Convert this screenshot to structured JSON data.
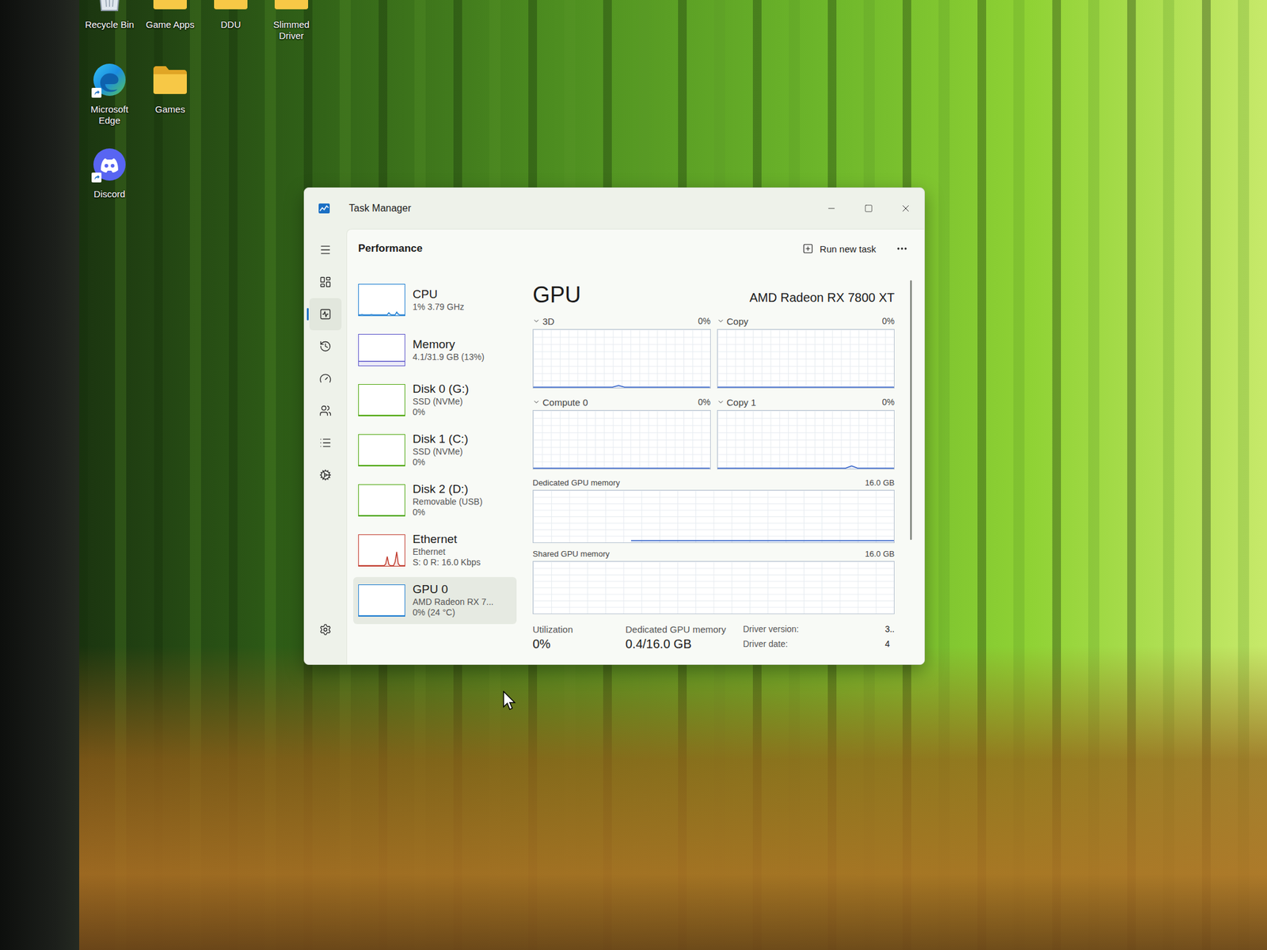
{
  "desktop": {
    "icon_rows": [
      [
        {
          "label": "Recycle Bin",
          "kind": "recycle",
          "shortcut": false
        },
        {
          "label": "Game Apps",
          "kind": "folder",
          "shortcut": false
        },
        {
          "label": "DDU",
          "kind": "folder",
          "shortcut": false
        },
        {
          "label": "Slimmed Driver",
          "kind": "folder",
          "shortcut": false
        }
      ],
      [
        {
          "label": "Microsoft Edge",
          "kind": "edge",
          "shortcut": true
        },
        {
          "label": "Games",
          "kind": "folder",
          "shortcut": false
        }
      ],
      [
        {
          "label": "Discord",
          "kind": "discord",
          "shortcut": true
        }
      ]
    ]
  },
  "window": {
    "title": "Task Manager"
  },
  "nav": {
    "items": [
      {
        "kind": "menu",
        "selected": false
      },
      {
        "kind": "processes",
        "selected": false
      },
      {
        "kind": "performance",
        "selected": true
      },
      {
        "kind": "history",
        "selected": false
      },
      {
        "kind": "startup",
        "selected": false
      },
      {
        "kind": "users",
        "selected": false
      },
      {
        "kind": "details",
        "selected": false
      },
      {
        "kind": "services",
        "selected": false
      }
    ],
    "footer": {
      "kind": "settings",
      "selected": false
    }
  },
  "header": {
    "title": "Performance",
    "action": "Run new task"
  },
  "devices": [
    {
      "name": "CPU",
      "lines": [
        "1% 3.79 GHz"
      ],
      "selected": false,
      "color": "#1a7bd0",
      "values": [
        1,
        1,
        2,
        1,
        1,
        1,
        1,
        1,
        2,
        1,
        1,
        1,
        1,
        1,
        1,
        1,
        1,
        1,
        1,
        8,
        2,
        1,
        1,
        1,
        10,
        3,
        1,
        1,
        1,
        1
      ]
    },
    {
      "name": "Memory",
      "lines": [
        "4.1/31.9 GB (13%)"
      ],
      "selected": false,
      "color": "#5b55c9",
      "values": [
        13,
        13,
        13,
        13,
        13,
        13,
        13,
        13,
        13,
        13,
        13,
        13,
        13,
        13,
        13,
        13,
        13,
        13,
        13,
        13,
        13,
        13,
        13,
        13,
        13,
        13,
        13,
        13,
        13,
        13
      ]
    },
    {
      "name": "Disk 0 (G:)",
      "lines": [
        "SSD (NVMe)",
        "0%"
      ],
      "selected": false,
      "color": "#4da60c",
      "values": [
        0,
        0,
        0,
        0,
        0,
        0,
        0,
        0,
        0,
        0,
        0,
        0,
        0,
        0,
        0,
        0,
        0,
        0,
        0,
        0,
        0,
        0,
        0,
        0,
        0,
        0,
        0,
        0,
        0,
        0
      ]
    },
    {
      "name": "Disk 1 (C:)",
      "lines": [
        "SSD (NVMe)",
        "0%"
      ],
      "selected": false,
      "color": "#4da60c",
      "values": [
        0,
        0,
        0,
        0,
        0,
        0,
        0,
        0,
        0,
        0,
        0,
        0,
        0,
        0,
        0,
        0,
        0,
        0,
        0,
        0,
        0,
        0,
        0,
        0,
        0,
        0,
        0,
        0,
        0,
        0
      ]
    },
    {
      "name": "Disk 2 (D:)",
      "lines": [
        "Removable (USB)",
        "0%"
      ],
      "selected": false,
      "color": "#4da60c",
      "values": [
        0,
        0,
        0,
        0,
        0,
        0,
        0,
        0,
        0,
        0,
        0,
        0,
        0,
        0,
        0,
        0,
        0,
        0,
        0,
        0,
        0,
        0,
        0,
        0,
        0,
        0,
        0,
        0,
        0,
        0
      ]
    },
    {
      "name": "Ethernet",
      "lines": [
        "Ethernet",
        "S: 0 R: 16.0 Kbps"
      ],
      "selected": false,
      "color": "#c0392b",
      "values": [
        0,
        0,
        0,
        0,
        0,
        0,
        0,
        0,
        0,
        0,
        0,
        0,
        0,
        0,
        0,
        0,
        0,
        5,
        30,
        4,
        0,
        0,
        0,
        12,
        45,
        6,
        0,
        0,
        0,
        0
      ]
    },
    {
      "name": "GPU 0",
      "lines": [
        "AMD Radeon RX 7...",
        "0% (24 °C)"
      ],
      "selected": true,
      "color": "#1a7bd0",
      "values": [
        0,
        0,
        0,
        0,
        0,
        0,
        0,
        0,
        0,
        0,
        0,
        0,
        0,
        0,
        0,
        0,
        0,
        0,
        0,
        0,
        0,
        0,
        0,
        0,
        0,
        0,
        0,
        0,
        0,
        0
      ]
    }
  ],
  "gpu": {
    "title": "GPU",
    "model": "AMD Radeon RX 7800 XT",
    "engines": [
      {
        "label": "3D",
        "reading": "0%",
        "values": [
          0,
          0,
          0,
          0,
          0,
          0,
          0,
          0,
          0,
          0,
          0,
          0,
          0,
          0,
          3,
          0,
          0,
          0,
          0,
          0,
          0,
          0,
          0,
          0,
          0,
          0,
          0,
          0,
          0,
          0
        ]
      },
      {
        "label": "Copy",
        "reading": "0%",
        "values": [
          0,
          0,
          0,
          0,
          0,
          0,
          0,
          0,
          0,
          0,
          0,
          0,
          0,
          0,
          0,
          0,
          0,
          0,
          0,
          0,
          0,
          0,
          0,
          0,
          0,
          0,
          0,
          0,
          0,
          0
        ]
      },
      {
        "label": "Compute 0",
        "reading": "0%",
        "values": [
          0,
          0,
          0,
          0,
          0,
          0,
          0,
          0,
          0,
          0,
          0,
          0,
          0,
          0,
          0,
          0,
          0,
          0,
          0,
          0,
          0,
          0,
          0,
          0,
          0,
          0,
          0,
          0,
          0,
          0
        ]
      },
      {
        "label": "Copy 1",
        "reading": "0%",
        "values": [
          0,
          0,
          0,
          0,
          0,
          0,
          0,
          0,
          0,
          0,
          0,
          0,
          0,
          0,
          0,
          0,
          0,
          0,
          0,
          0,
          0,
          0,
          4,
          0,
          0,
          0,
          0,
          0,
          0,
          0
        ]
      }
    ],
    "memory": [
      {
        "label": "Dedicated GPU memory",
        "max": "16.0 GB",
        "values": [
          0.4,
          0.4,
          0.4,
          0.4,
          0.4,
          0.4,
          0.4,
          0.4,
          0.4,
          0.4,
          0.4,
          0.4,
          0.4,
          0.4,
          0.4,
          0.4,
          0.4,
          0.4,
          0.4,
          0.4,
          0.4,
          0.4,
          0.4,
          0.4,
          0.4,
          0.4,
          0.4,
          0.4,
          0.4,
          0.4,
          0.4,
          0.4,
          0.4,
          0.4,
          0.4,
          0.4,
          0.4,
          0.4,
          0.4,
          0.4,
          0.4,
          0.4,
          0.4,
          0.4
        ]
      },
      {
        "label": "Shared GPU memory",
        "max": "16.0 GB",
        "values": []
      }
    ],
    "stats": [
      {
        "label": "Utilization",
        "value": "0%"
      },
      {
        "label": "Dedicated GPU memory",
        "value": "0.4/16.0 GB"
      }
    ],
    "details": [
      {
        "label": "Driver version:",
        "value": "3.."
      },
      {
        "label": "Driver date:",
        "value": "4"
      }
    ]
  }
}
